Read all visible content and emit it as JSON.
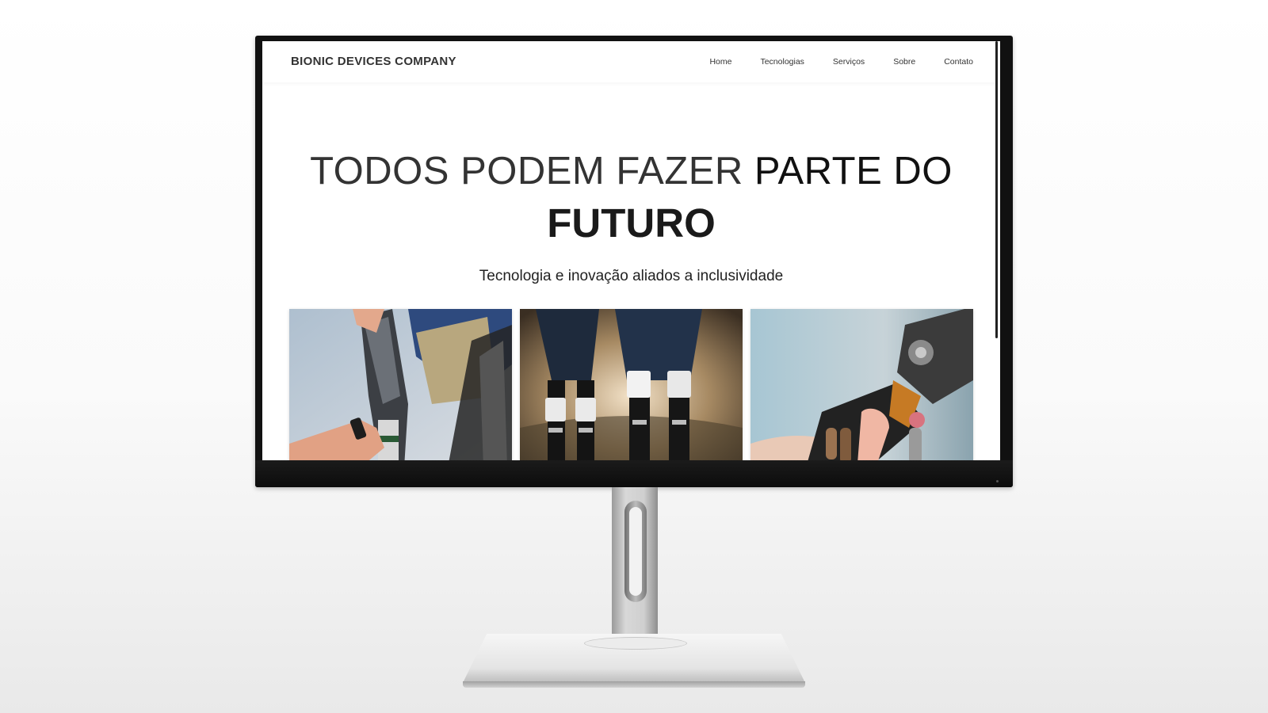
{
  "site": {
    "logo": "BIONIC DEVICES COMPANY",
    "nav": [
      "Home",
      "Tecnologias",
      "Serviços",
      "Sobre",
      "Contato"
    ]
  },
  "hero": {
    "title_light": "TODOS PODEM FAZER",
    "title_dark": "PARTE DO",
    "title_bold": "FUTURO",
    "subtitle": "Tecnologia e inovação aliados a inclusividade"
  },
  "gallery": [
    {
      "name": "prosthetic-leg-photo"
    },
    {
      "name": "bionic-legs-photo"
    },
    {
      "name": "robotic-hand-photo"
    }
  ],
  "colors": {
    "text_dark": "#1a1a1a",
    "text_mid": "#333333",
    "bezel": "#111111",
    "stand": "#d0d0d0"
  }
}
